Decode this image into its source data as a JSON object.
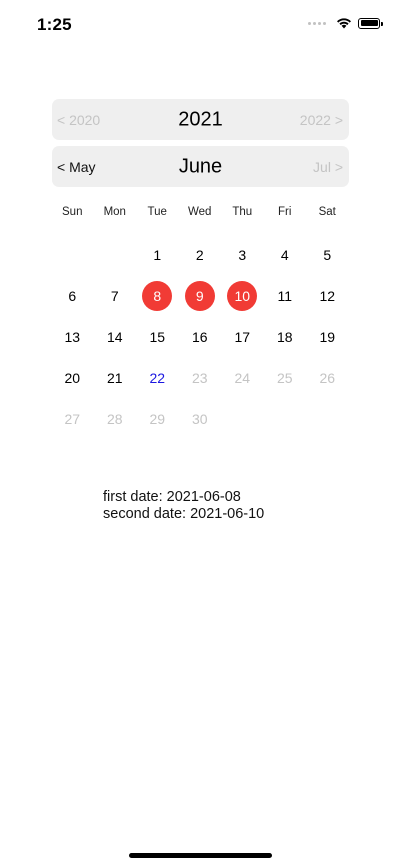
{
  "status_bar": {
    "time": "1:25",
    "icons": [
      "cellular-signal-icon",
      "wifi-icon",
      "battery-icon"
    ]
  },
  "year_nav": {
    "prev": "< 2020",
    "current": "2021",
    "next": "2022 >"
  },
  "month_nav": {
    "prev": "< May",
    "current": "June",
    "next": "Jul >"
  },
  "weekdays": [
    "Sun",
    "Mon",
    "Tue",
    "Wed",
    "Thu",
    "Fri",
    "Sat"
  ],
  "calendar": {
    "weeks": [
      [
        "",
        "",
        "1",
        "2",
        "3",
        "4",
        "5"
      ],
      [
        "6",
        "7",
        "8",
        "9",
        "10",
        "11",
        "12"
      ],
      [
        "13",
        "14",
        "15",
        "16",
        "17",
        "18",
        "19"
      ],
      [
        "20",
        "21",
        "22",
        "23",
        "24",
        "25",
        "26"
      ],
      [
        "27",
        "28",
        "29",
        "30",
        "",
        "",
        ""
      ]
    ],
    "selected_days": [
      "8",
      "9",
      "10"
    ],
    "today": "22",
    "disabled_days": [
      "23",
      "24",
      "25",
      "26",
      "27",
      "28",
      "29",
      "30"
    ]
  },
  "result": {
    "first": "first date: 2021-06-08",
    "second": "second date: 2021-06-10"
  },
  "colors": {
    "selected": "#f13b35",
    "today": "#1b17e0",
    "disabled": "#c4c4c4",
    "nav_bg": "#efefef"
  }
}
